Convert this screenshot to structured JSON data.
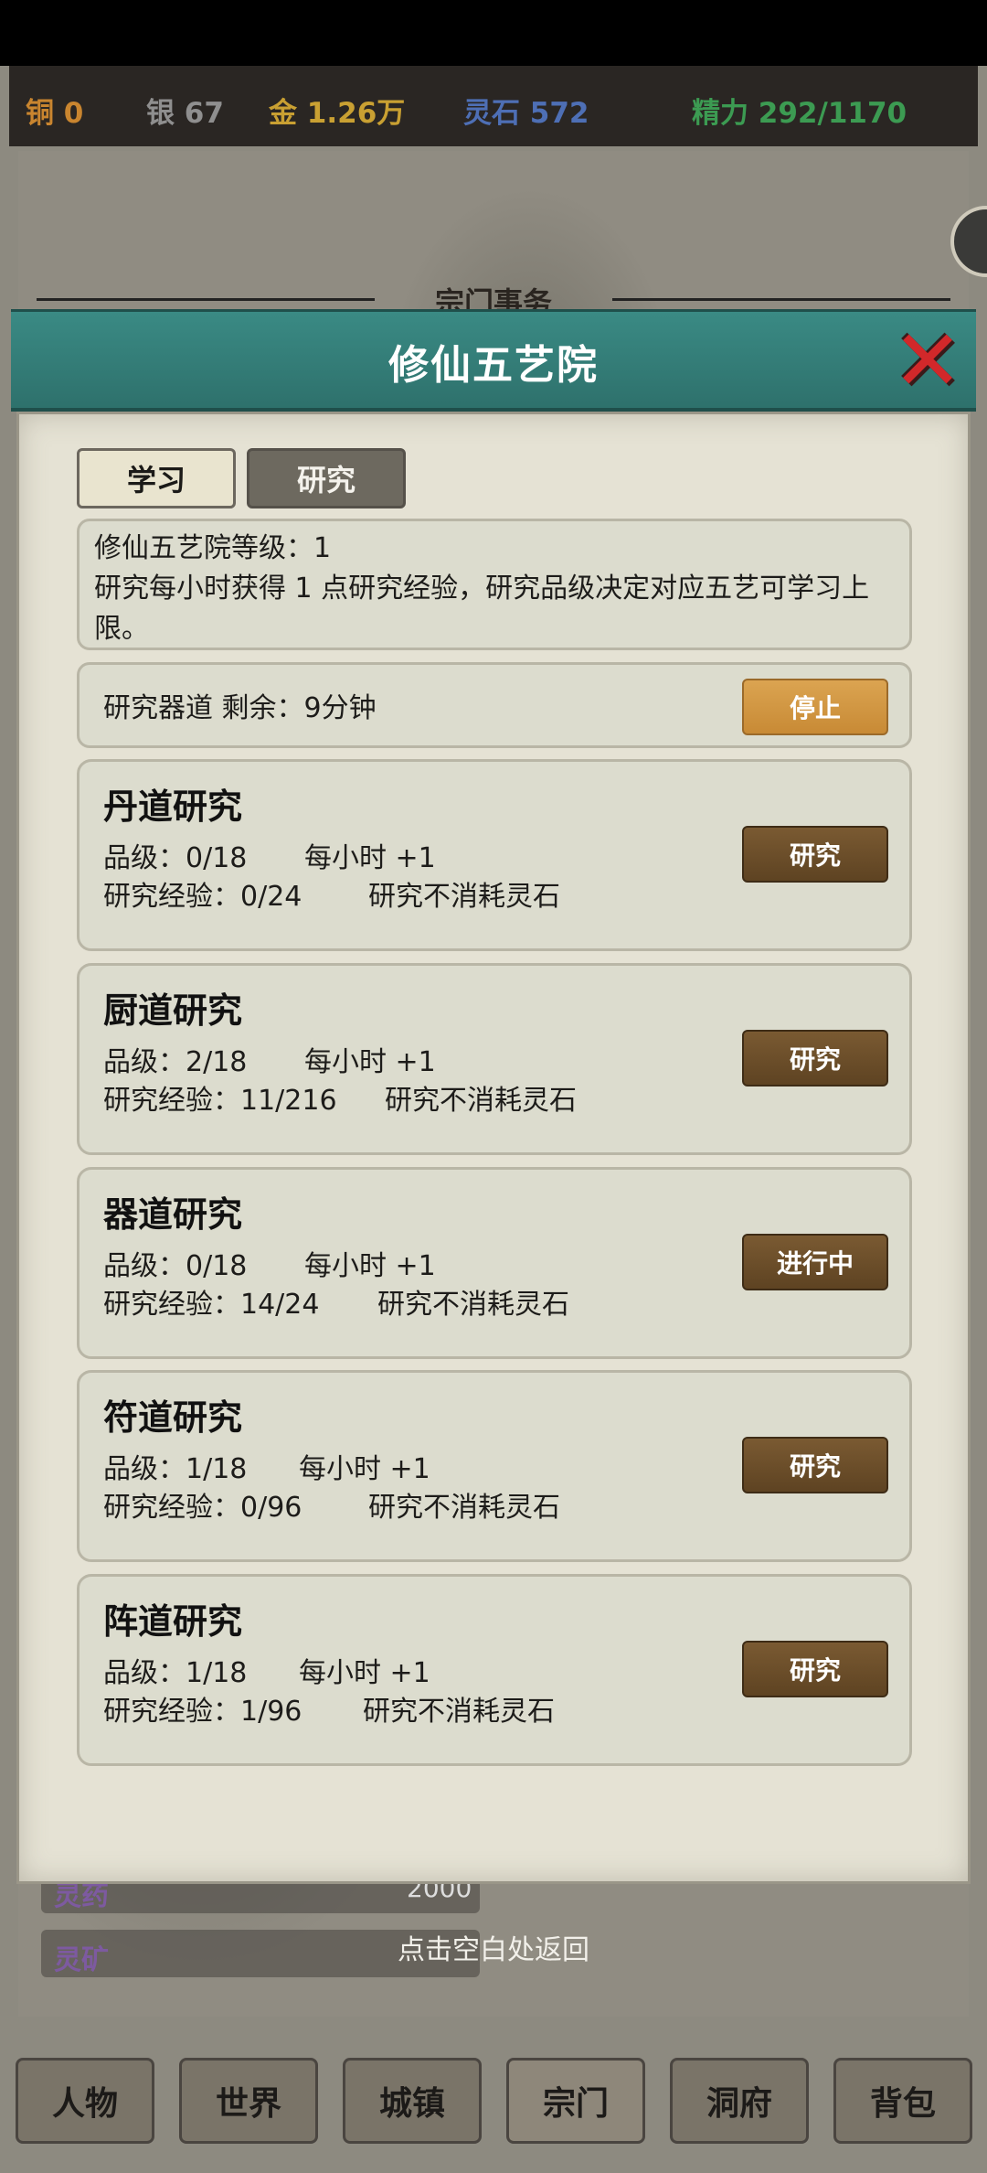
{
  "currencies": [
    {
      "label": "铜",
      "value": "0",
      "color": "#c9852f"
    },
    {
      "label": "银",
      "value": "67",
      "color": "#8f8f8f"
    },
    {
      "label": "金",
      "value": "1.26万",
      "color": "#c9a032"
    },
    {
      "label": "灵石",
      "value": "572",
      "color": "#4e6fb5"
    },
    {
      "label": "精力",
      "value": "292/1170",
      "color": "#3c9b52"
    }
  ],
  "section_title": "宗门事务",
  "modal": {
    "title": "修仙五艺院",
    "close_icon": "close-x-icon"
  },
  "tabs": {
    "study": "学习",
    "research": "研究",
    "active": "研究"
  },
  "info": {
    "level_line": "修仙五艺院等级：1",
    "desc": "研究每小时获得 1 点研究经验，研究品级决定对应五艺可学习上限。"
  },
  "current": {
    "text": "研究器道  剩余：9分钟",
    "stop_label": "停止"
  },
  "research_items": [
    {
      "name": "丹道研究",
      "grade": "品级：0/18",
      "rate": "每小时 +1",
      "exp": "研究经验：0/24",
      "note": "研究不消耗灵石",
      "button": "研究"
    },
    {
      "name": "厨道研究",
      "grade": "品级：2/18",
      "rate": "每小时 +1",
      "exp": "研究经验：11/216",
      "note": "研究不消耗灵石",
      "button": "研究"
    },
    {
      "name": "器道研究",
      "grade": "品级：0/18",
      "rate": "每小时 +1",
      "exp": "研究经验：14/24",
      "note": "研究不消耗灵石",
      "button": "进行中"
    },
    {
      "name": "符道研究",
      "grade": "品级：1/18",
      "rate": "每小时 +1",
      "exp": "研究经验：0/96",
      "note": "研究不消耗灵石",
      "button": "研究"
    },
    {
      "name": "阵道研究",
      "grade": "品级：1/18",
      "rate": "每小时 +1",
      "exp": "研究经验：1/96",
      "note": "研究不消耗灵石",
      "button": "研究"
    }
  ],
  "background_rows": [
    {
      "label": "灵药",
      "value": "2000"
    },
    {
      "label": "灵矿",
      "value": ""
    }
  ],
  "return_hint": "点击空白处返回",
  "bottom_nav": [
    {
      "label": "人物"
    },
    {
      "label": "世界"
    },
    {
      "label": "城镇"
    },
    {
      "label": "宗门"
    },
    {
      "label": "洞府"
    },
    {
      "label": "背包"
    }
  ],
  "bottom_nav_active": "宗门"
}
